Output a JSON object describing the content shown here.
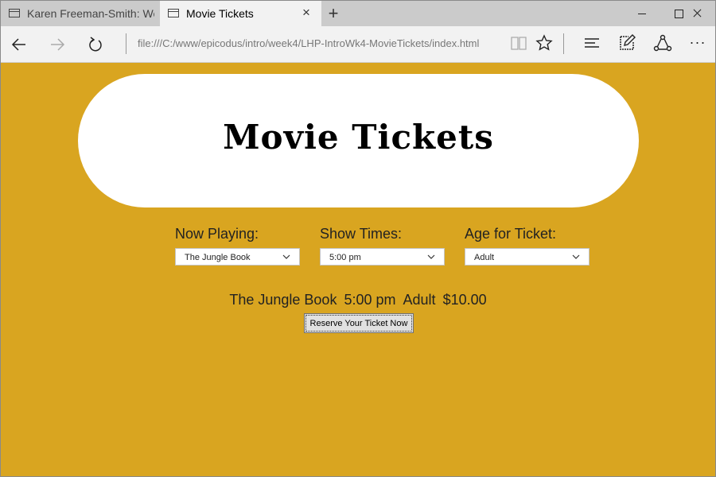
{
  "browser": {
    "tabs": [
      {
        "title": "Karen Freeman-Smith: Web"
      },
      {
        "title": "Movie Tickets"
      }
    ],
    "url": "file:///C:/www/epicodus/intro/week4/LHP-IntroWk4-MovieTickets/index.html",
    "icons": {
      "back": "back-arrow-icon",
      "forward": "forward-arrow-icon",
      "refresh": "refresh-icon",
      "reading": "reading-view-icon",
      "favorite": "star-icon",
      "hub": "hub-icon",
      "notes": "web-note-icon",
      "share": "share-icon",
      "more": "ellipsis-icon"
    },
    "more_label": "···",
    "new_tab_label": "+",
    "close_tab_label": "×"
  },
  "page": {
    "title": "Movie Tickets",
    "background_color": "#d9a520",
    "fields": {
      "movie": {
        "label": "Now Playing:",
        "value": "The Jungle Book"
      },
      "time": {
        "label": "Show Times:",
        "value": "5:00 pm"
      },
      "age": {
        "label": "Age for Ticket:",
        "value": "Adult"
      }
    },
    "summary": {
      "movie": "The Jungle Book",
      "time": "5:00 pm",
      "age": "Adult",
      "price": "$10.00"
    },
    "reserve_button": "Reserve Your Ticket Now"
  }
}
